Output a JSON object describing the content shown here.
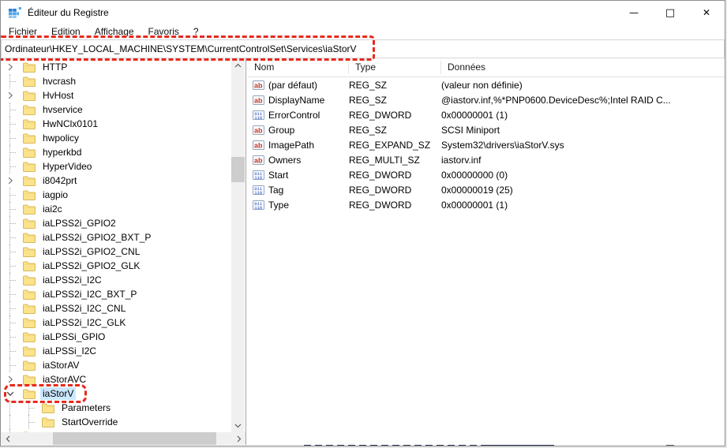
{
  "window": {
    "title": "Éditeur du Registre",
    "minimize_glyph": "—",
    "maximize_glyph": "□",
    "close_glyph": "✕"
  },
  "menu": {
    "items": [
      "Fichier",
      "Edition",
      "Affichage",
      "Favoris",
      "?"
    ]
  },
  "address_bar": {
    "value": "Ordinateur\\HKEY_LOCAL_MACHINE\\SYSTEM\\CurrentControlSet\\Services\\iaStorV"
  },
  "tree": {
    "items": [
      {
        "label": "HTTP",
        "state": "collapsed",
        "level": 0
      },
      {
        "label": "hvcrash",
        "state": "leaf",
        "level": 0
      },
      {
        "label": "HvHost",
        "state": "collapsed",
        "level": 0
      },
      {
        "label": "hvservice",
        "state": "leaf",
        "level": 0
      },
      {
        "label": "HwNClx0101",
        "state": "leaf",
        "level": 0
      },
      {
        "label": "hwpolicy",
        "state": "leaf",
        "level": 0
      },
      {
        "label": "hyperkbd",
        "state": "leaf",
        "level": 0
      },
      {
        "label": "HyperVideo",
        "state": "leaf",
        "level": 0
      },
      {
        "label": "i8042prt",
        "state": "collapsed",
        "level": 0
      },
      {
        "label": "iagpio",
        "state": "leaf",
        "level": 0
      },
      {
        "label": "iai2c",
        "state": "leaf",
        "level": 0
      },
      {
        "label": "iaLPSS2i_GPIO2",
        "state": "leaf",
        "level": 0
      },
      {
        "label": "iaLPSS2i_GPIO2_BXT_P",
        "state": "leaf",
        "level": 0
      },
      {
        "label": "iaLPSS2i_GPIO2_CNL",
        "state": "leaf",
        "level": 0
      },
      {
        "label": "iaLPSS2i_GPIO2_GLK",
        "state": "leaf",
        "level": 0
      },
      {
        "label": "iaLPSS2i_I2C",
        "state": "leaf",
        "level": 0
      },
      {
        "label": "iaLPSS2i_I2C_BXT_P",
        "state": "leaf",
        "level": 0
      },
      {
        "label": "iaLPSS2i_I2C_CNL",
        "state": "leaf",
        "level": 0
      },
      {
        "label": "iaLPSS2i_I2C_GLK",
        "state": "leaf",
        "level": 0
      },
      {
        "label": "iaLPSSi_GPIO",
        "state": "leaf",
        "level": 0
      },
      {
        "label": "iaLPSSi_I2C",
        "state": "leaf",
        "level": 0
      },
      {
        "label": "iaStorAV",
        "state": "leaf",
        "level": 0
      },
      {
        "label": "iaStorAVC",
        "state": "collapsed",
        "level": 0
      },
      {
        "label": "iaStorV",
        "state": "expanded",
        "level": 0,
        "selected": true
      },
      {
        "label": "Parameters",
        "state": "leaf",
        "level": 1
      },
      {
        "label": "StartOverride",
        "state": "leaf",
        "level": 1
      },
      {
        "label": "",
        "state": "leaf",
        "level": 0
      }
    ]
  },
  "values_panel": {
    "columns": [
      "Nom",
      "Type",
      "Données"
    ],
    "rows": [
      {
        "icon": "string",
        "name": "(par défaut)",
        "type": "REG_SZ",
        "data": "(valeur non définie)"
      },
      {
        "icon": "string",
        "name": "DisplayName",
        "type": "REG_SZ",
        "data": "@iastorv.inf,%*PNP0600.DeviceDesc%;Intel RAID C..."
      },
      {
        "icon": "dword",
        "name": "ErrorControl",
        "type": "REG_DWORD",
        "data": "0x00000001 (1)"
      },
      {
        "icon": "string",
        "name": "Group",
        "type": "REG_SZ",
        "data": "SCSI Miniport"
      },
      {
        "icon": "string",
        "name": "ImagePath",
        "type": "REG_EXPAND_SZ",
        "data": "System32\\drivers\\iaStorV.sys"
      },
      {
        "icon": "string",
        "name": "Owners",
        "type": "REG_MULTI_SZ",
        "data": "iastorv.inf"
      },
      {
        "icon": "dword",
        "name": "Start",
        "type": "REG_DWORD",
        "data": "0x00000000 (0)"
      },
      {
        "icon": "dword",
        "name": "Tag",
        "type": "REG_DWORD",
        "data": "0x00000019 (25)"
      },
      {
        "icon": "dword",
        "name": "Type",
        "type": "REG_DWORD",
        "data": "0x00000001 (1)"
      }
    ]
  },
  "colors": {
    "annotation_red": "#e8291d",
    "selection_blue": "#cce8ff",
    "folder_yellow": "#fbe38b",
    "string_icon_red": "#c0392b",
    "dword_icon_blue": "#1b46c2"
  }
}
